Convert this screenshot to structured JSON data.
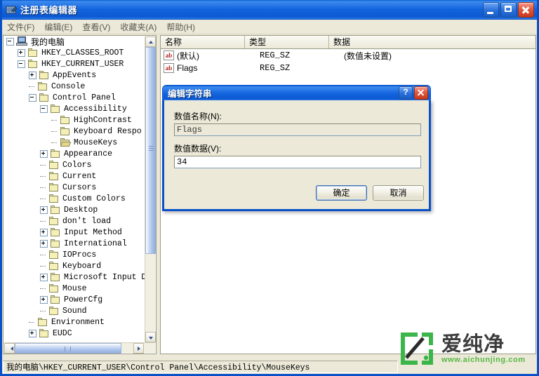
{
  "window": {
    "title": "注册表编辑器",
    "icon": "registry-editor-icon",
    "buttons": {
      "minimize": "_",
      "maximize": "□",
      "close": "✕"
    },
    "accent_color": "#0a51c8",
    "titlebar_color": "#1264dd",
    "face_color": "#ece9d8"
  },
  "menu": [
    {
      "label": "文件(F)"
    },
    {
      "label": "编辑(E)"
    },
    {
      "label": "查看(V)"
    },
    {
      "label": "收藏夹(A)"
    },
    {
      "label": "帮助(H)"
    }
  ],
  "tree": {
    "nodes": [
      {
        "label": "我的电脑",
        "indent": 0,
        "toggle": "minus",
        "icon": "computer"
      },
      {
        "label": "HKEY_CLASSES_ROOT",
        "indent": 1,
        "toggle": "plus",
        "icon": "folder"
      },
      {
        "label": "HKEY_CURRENT_USER",
        "indent": 1,
        "toggle": "minus",
        "icon": "folder"
      },
      {
        "label": "AppEvents",
        "indent": 2,
        "toggle": "plus",
        "icon": "folder"
      },
      {
        "label": "Console",
        "indent": 2,
        "toggle": "none",
        "icon": "folder"
      },
      {
        "label": "Control Panel",
        "indent": 2,
        "toggle": "minus",
        "icon": "folder"
      },
      {
        "label": "Accessibility",
        "indent": 3,
        "toggle": "minus",
        "icon": "folder"
      },
      {
        "label": "HighContrast",
        "indent": 4,
        "toggle": "none",
        "icon": "folder"
      },
      {
        "label": "Keyboard Respo",
        "indent": 4,
        "toggle": "none",
        "icon": "folder"
      },
      {
        "label": "MouseKeys",
        "indent": 4,
        "toggle": "none",
        "icon": "folder-open"
      },
      {
        "label": "Appearance",
        "indent": 3,
        "toggle": "plus",
        "icon": "folder"
      },
      {
        "label": "Colors",
        "indent": 3,
        "toggle": "none",
        "icon": "folder"
      },
      {
        "label": "Current",
        "indent": 3,
        "toggle": "none",
        "icon": "folder"
      },
      {
        "label": "Cursors",
        "indent": 3,
        "toggle": "none",
        "icon": "folder"
      },
      {
        "label": "Custom Colors",
        "indent": 3,
        "toggle": "none",
        "icon": "folder"
      },
      {
        "label": "Desktop",
        "indent": 3,
        "toggle": "plus",
        "icon": "folder"
      },
      {
        "label": "don't load",
        "indent": 3,
        "toggle": "none",
        "icon": "folder"
      },
      {
        "label": "Input Method",
        "indent": 3,
        "toggle": "plus",
        "icon": "folder"
      },
      {
        "label": "International",
        "indent": 3,
        "toggle": "plus",
        "icon": "folder"
      },
      {
        "label": "IOProcs",
        "indent": 3,
        "toggle": "none",
        "icon": "folder"
      },
      {
        "label": "Keyboard",
        "indent": 3,
        "toggle": "none",
        "icon": "folder"
      },
      {
        "label": "Microsoft Input D",
        "indent": 3,
        "toggle": "plus",
        "icon": "folder"
      },
      {
        "label": "Mouse",
        "indent": 3,
        "toggle": "none",
        "icon": "folder"
      },
      {
        "label": "PowerCfg",
        "indent": 3,
        "toggle": "plus",
        "icon": "folder"
      },
      {
        "label": "Sound",
        "indent": 3,
        "toggle": "none",
        "icon": "folder"
      },
      {
        "label": "Environment",
        "indent": 2,
        "toggle": "none",
        "icon": "folder"
      },
      {
        "label": "EUDC",
        "indent": 2,
        "toggle": "plus",
        "icon": "folder"
      }
    ]
  },
  "list": {
    "columns": [
      {
        "label": "名称"
      },
      {
        "label": "类型"
      },
      {
        "label": "数据"
      }
    ],
    "rows": [
      {
        "icon": "string-value-icon",
        "name": "(默认)",
        "type": "REG_SZ",
        "data": "(数值未设置)"
      },
      {
        "icon": "string-value-icon",
        "name": "Flags",
        "type": "REG_SZ",
        "data": ""
      }
    ]
  },
  "dialog": {
    "title": "编辑字符串",
    "help_button": "?",
    "close_button": "✕",
    "name_label": "数值名称(N):",
    "name_value": "Flags",
    "data_label": "数值数据(V):",
    "data_value": "34",
    "ok_label": "确定",
    "cancel_label": "取消"
  },
  "statusbar": {
    "path": "我的电脑\\HKEY_CURRENT_USER\\Control Panel\\Accessibility\\MouseKeys"
  },
  "watermark": {
    "name": "爱纯净",
    "url": "www.aichunjing.com",
    "color": "#57b847"
  }
}
